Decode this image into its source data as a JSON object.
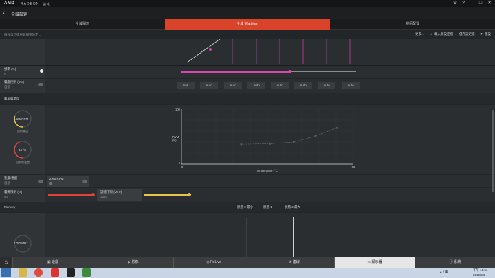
{
  "titlebar": {
    "brand": "AMD",
    "product": "RADEON",
    "suffix": "設定"
  },
  "header": {
    "title": "全域設定"
  },
  "tabs": [
    {
      "label": "全域圖形"
    },
    {
      "label": "全域 WattMan"
    },
    {
      "label": "視訊配置"
    }
  ],
  "toolbar": {
    "hint": "檢視自訂或重新調整設定 ...",
    "more": "更多...",
    "import": "載入新設定檔",
    "save": "儲存設定檔",
    "reset": "重設"
  },
  "gpu": {
    "frequency_label": "頻率 (%)",
    "frequency_value": "0",
    "voltage_label": "電壓控制 (mV)",
    "voltage_value": "自動",
    "state_buttons": [
      "N/A",
      "Auto",
      "Auto",
      "Auto",
      "Auto",
      "Auto",
      "Auto",
      "Auto"
    ],
    "frequency_slider": 0.62
  },
  "fan": {
    "section_title": "風扇與溫度",
    "rpm": "1425 RPM",
    "rpm_label": "目前轉速",
    "temp": "44 °C",
    "temp_label": "目前的溫度",
    "rpm_fill": 0.3,
    "temp_fill": 0.42,
    "chart_data": {
      "type": "line",
      "xlabel": "Temperature (°C)",
      "ylabel": "PWM (%)",
      "y_max_label": "100",
      "y_min_label": "0",
      "x_min_label": "0",
      "x_max_label": "95",
      "xlim": [
        0,
        95
      ],
      "ylim": [
        0,
        100
      ],
      "x": [
        33,
        49,
        62,
        74,
        86
      ],
      "y": [
        36,
        37,
        40,
        51,
        66
      ]
    },
    "speed_label": "速度/溫度",
    "speed_value": "自動",
    "zero_rpm_label": "Zero RPM",
    "power_label": "電源限制 (%)",
    "power_value": "50",
    "min_accel_label": "調速下限 (MHz)",
    "min_accel_value": "1340",
    "power_slider": 0.5
  },
  "memory": {
    "section_title": "Memory",
    "states": [
      "狀態 0 最小",
      "狀態 1",
      "狀態 2 最大"
    ],
    "frequency": "1750 MHz"
  },
  "nav": [
    {
      "label": "遊戲",
      "icon": "gamepad-icon"
    },
    {
      "label": "影像",
      "icon": "play-icon"
    },
    {
      "label": "ReLive",
      "icon": "relive-icon"
    },
    {
      "label": "連線",
      "icon": "share-icon"
    },
    {
      "label": "顯示器",
      "icon": "monitor-icon"
    },
    {
      "label": "系統",
      "icon": "info-icon"
    }
  ],
  "taskbar": {
    "time": "下午 10:51",
    "date": "2019/2/6"
  }
}
